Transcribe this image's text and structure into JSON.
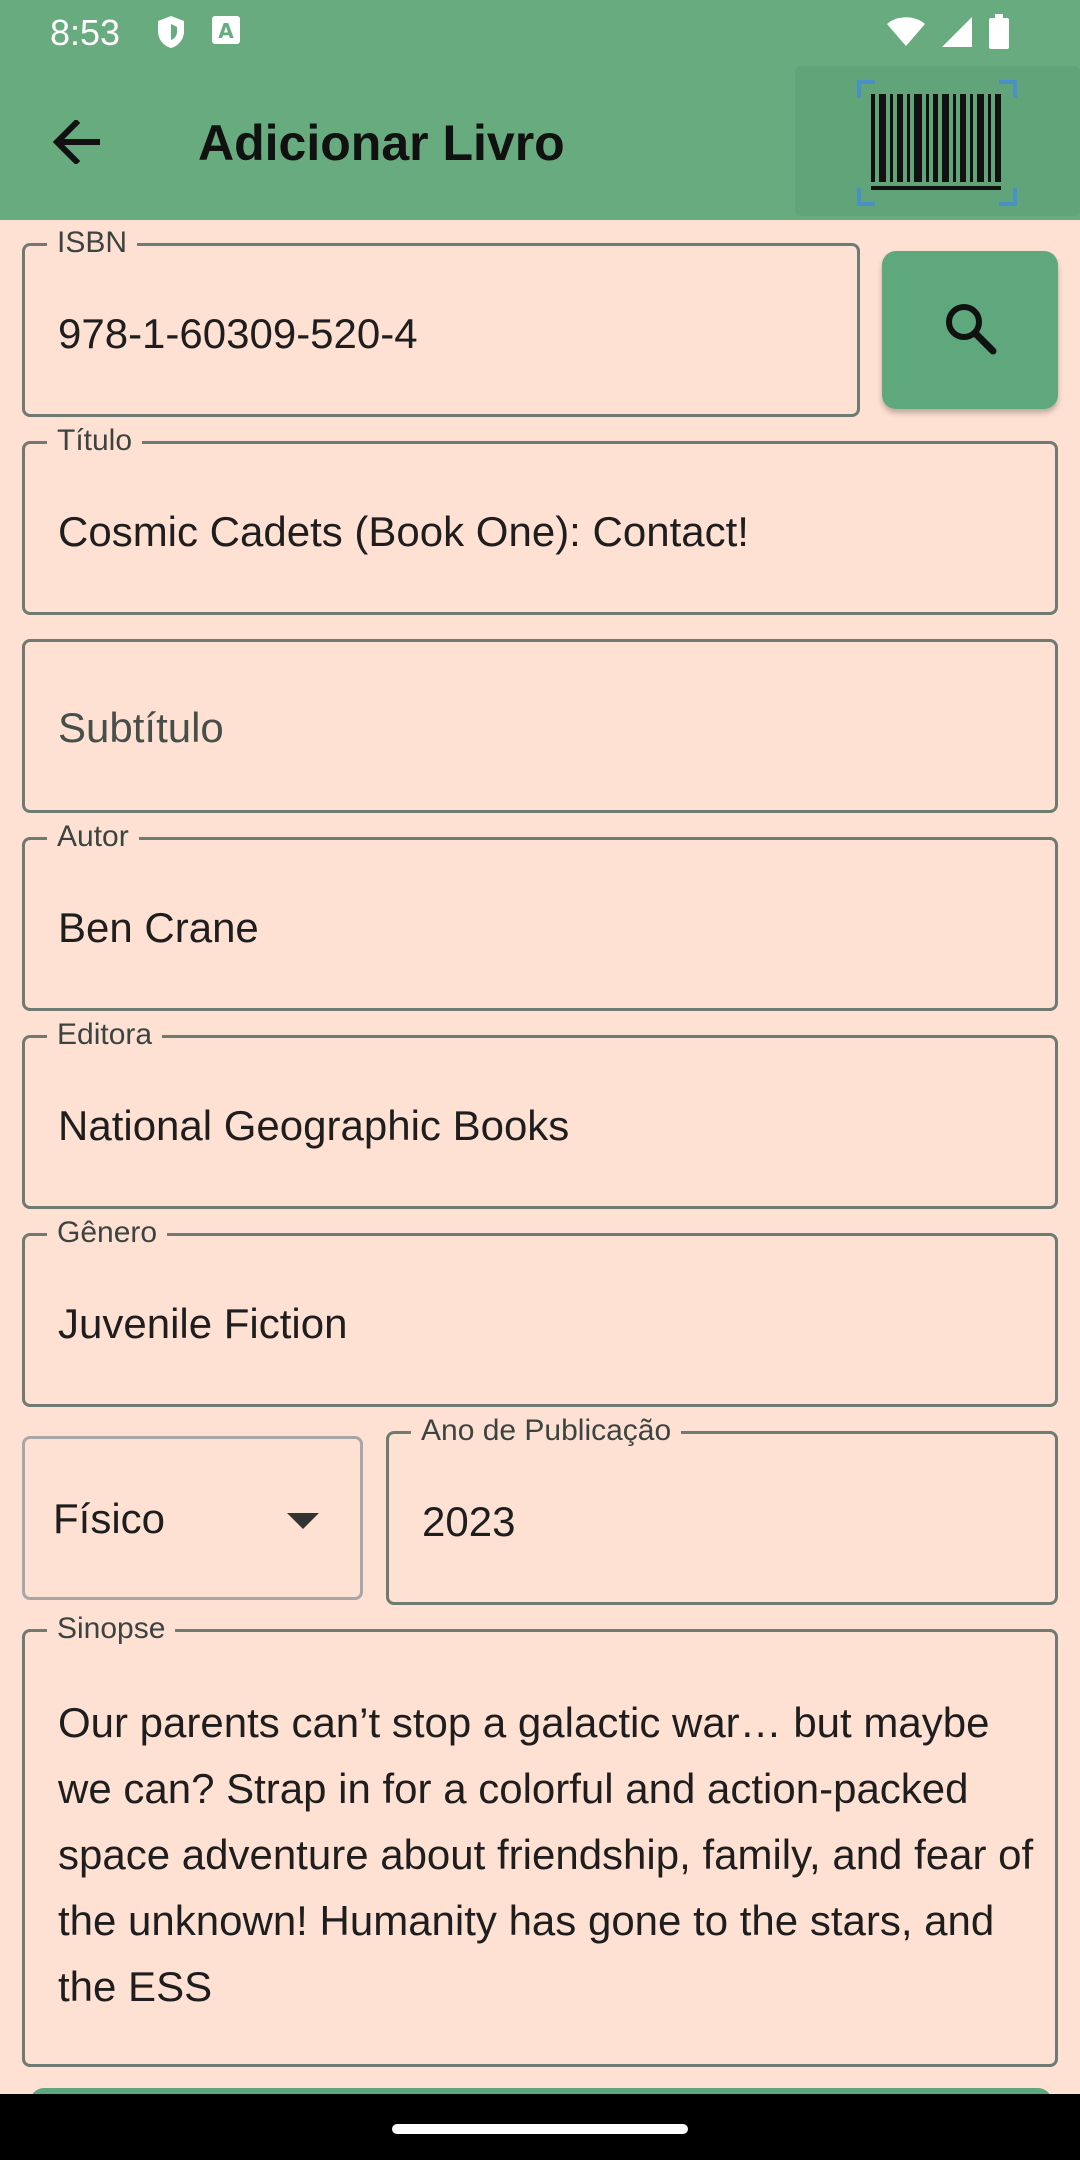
{
  "status_bar": {
    "time": "8:53",
    "icons": [
      "shield-icon",
      "font-a-icon",
      "wifi-icon",
      "signal-icon",
      "battery-icon"
    ]
  },
  "app_bar": {
    "title": "Adicionar Livro",
    "back_icon": "arrow-back-icon",
    "scan_icon": "barcode-scan-icon"
  },
  "form": {
    "isbn": {
      "label": "ISBN",
      "value": "978-1-60309-520-4"
    },
    "search_icon": "search-icon",
    "titulo": {
      "label": "Título",
      "value": "Cosmic Cadets (Book One): Contact!"
    },
    "subtitulo": {
      "placeholder": "Subtítulo"
    },
    "autor": {
      "label": "Autor",
      "value": "Ben Crane"
    },
    "editora": {
      "label": "Editora",
      "value": "National Geographic Books"
    },
    "genero": {
      "label": "Gênero",
      "value": "Juvenile Fiction"
    },
    "formato": {
      "value": "Físico"
    },
    "ano": {
      "label": "Ano de Publicação",
      "value": "2023"
    },
    "sinopse": {
      "label": "Sinopse",
      "value": "Our parents can’t stop a galactic war… but maybe we can? Strap in for a colorful and action-packed space adventure about friendship, family, and fear of the unknown! Humanity has gone to the stars, and the ESS"
    }
  },
  "colors": {
    "primary": "#68AB7E",
    "background": "#FFE1D4",
    "button": "#5FA87D"
  }
}
